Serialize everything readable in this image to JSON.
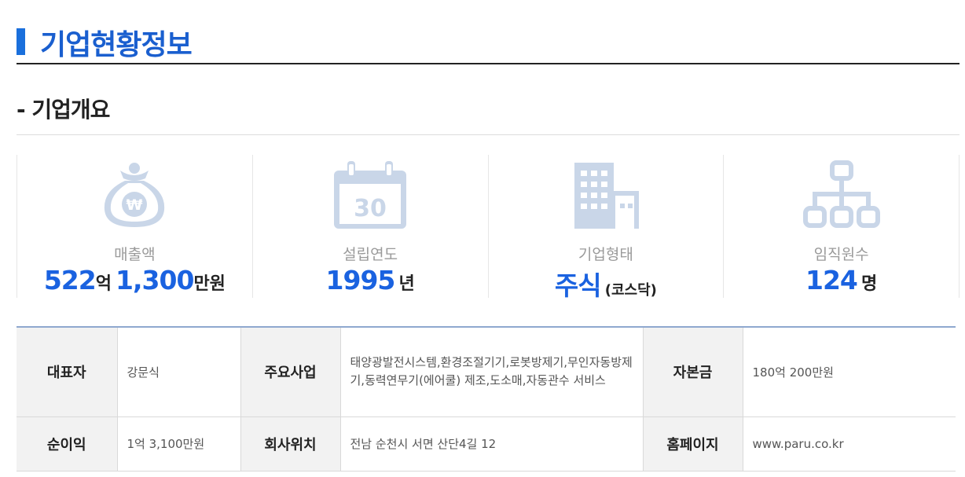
{
  "header": {
    "title": "기업현황정보"
  },
  "overview": {
    "title": "- 기업개요",
    "stats": [
      {
        "icon": "money-bag-icon",
        "label": "매출액",
        "num1": "522",
        "unit1": "억",
        "num2": "1,300",
        "unit2": "만원"
      },
      {
        "icon": "calendar-icon",
        "label": "설립연도",
        "calendar_day": "30",
        "num1": "1995",
        "unit1": "년"
      },
      {
        "icon": "building-icon",
        "label": "기업형태",
        "num1": "주식",
        "unit1": "(코스닥)"
      },
      {
        "icon": "org-chart-icon",
        "label": "임직원수",
        "num1": "124",
        "unit1": "명"
      }
    ]
  },
  "info": {
    "ceo": {
      "label": "대표자",
      "value": "강문식"
    },
    "business": {
      "label": "주요사업",
      "value": "태양광발전시스템,환경조절기기,로봇방제기,무인자동방제기,동력연무기(에어쿨) 제조,도소매,자동관수 서비스"
    },
    "capital": {
      "label": "자본금",
      "value": "180억 200만원"
    },
    "net_income": {
      "label": "순이익",
      "value": "1억 3,100만원"
    },
    "location": {
      "label": "회사위치",
      "value": "전남 순천시 서면 산단4길 12"
    },
    "homepage": {
      "label": "홈페이지",
      "value": "www.paru.co.kr"
    }
  },
  "colors": {
    "accent": "#1a62e0",
    "icon": "#c9d6e8",
    "label_gray": "#9a9a9a",
    "table_border": "#8fa8cf"
  }
}
